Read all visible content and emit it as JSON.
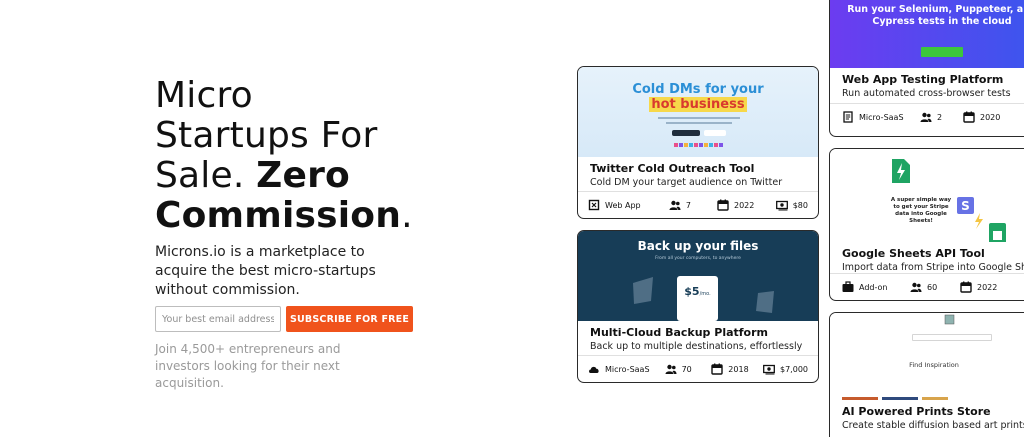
{
  "hero": {
    "title_line1": "Micro",
    "title_line2": "Startups For",
    "title_line3a": "Sale. ",
    "title_line3b": "Zero",
    "title_line4a": "Commission",
    "title_line4b": ".",
    "description": "Microns.io is a marketplace to acquire the best micro-startups without commission.",
    "email_placeholder": "Your best email address*",
    "subscribe_label": "SUBSCRIBE FOR FREE",
    "note": "Join 4,500+ entrepreneurs and investors looking for their next acquisition."
  },
  "listings": [
    {
      "title": "Twitter Cold Outreach Tool",
      "description": "Cold DM your target audience on Twitter",
      "image_line1": "Cold DMs for your",
      "image_line2": "hot business",
      "type": "Web App",
      "type_icon": "web-app-icon",
      "team": "7",
      "year": "2022",
      "price": "$80"
    },
    {
      "title": "Multi-Cloud Backup Platform",
      "description": "Back up to multiple destinations, effortlessly",
      "image_heading": "Back up your files",
      "image_subheading": "From all your computers, to anywhere",
      "image_price": "$5",
      "image_price_unit": "/mo.",
      "type": "Micro-SaaS",
      "type_icon": "cloud-icon",
      "team": "70",
      "year": "2018",
      "price": "$7,000"
    },
    {
      "title": "Web App Testing Platform",
      "description": "Run automated cross-browser tests",
      "image_heading": "Run your Selenium, Puppeteer, and Cypress tests in the cloud",
      "type": "Micro-SaaS",
      "type_icon": "document-icon",
      "team": "2",
      "year": "2020"
    },
    {
      "title": "Google Sheets API Tool",
      "description": "Import data from Stripe into Google Sheets",
      "image_text": "A super simple way to get your Stripe data into Google Sheets!",
      "type": "Add-on",
      "type_icon": "briefcase-icon",
      "team": "60",
      "year": "2022"
    },
    {
      "title": "AI Powered Prints Store",
      "description": "Create stable diffusion based art prints",
      "image_heading": "Find Inspiration"
    }
  ],
  "colors": {
    "accent": "#f0531c",
    "card_border": "#2a2a2a",
    "twitter_blue": "#2b8fd6",
    "twitter_red": "#d93a2e",
    "backup_navy": "#173d57",
    "webapp_purple": "#6c3cf0",
    "sheets_green": "#1fa463",
    "stripe_purple": "#6772e5"
  }
}
